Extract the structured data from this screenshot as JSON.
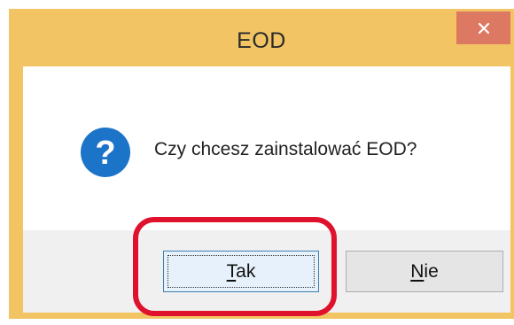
{
  "window": {
    "title": "EOD",
    "close_glyph": "×",
    "close_icon": "close-icon",
    "titlebar_color": "#f2c463",
    "close_button_color": "#dd7863"
  },
  "dialog": {
    "icon": "question-icon",
    "icon_color": "#1c74c9",
    "message": "Czy chcesz zainstalować EOD?"
  },
  "buttons": {
    "yes": {
      "accel": "T",
      "rest": "ak"
    },
    "no": {
      "accel": "N",
      "rest": "ie"
    }
  },
  "annotation": {
    "highlight_color": "#e0112c",
    "highlighted": "yes"
  }
}
